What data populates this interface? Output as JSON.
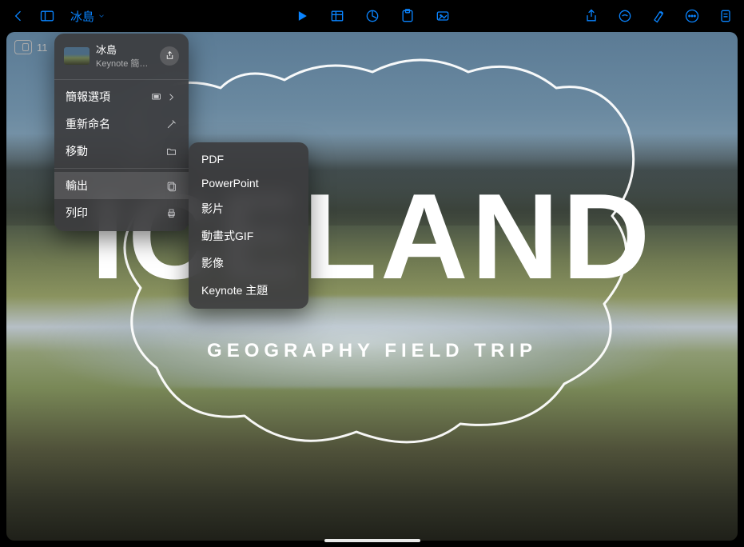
{
  "toolbar": {
    "doc_title": "冰島"
  },
  "slide_nav": {
    "count": "11"
  },
  "menu": {
    "header": {
      "title": "冰島",
      "subtitle": "Keynote 簡報⋯"
    },
    "items": {
      "options": "簡報選項",
      "rename": "重新命名",
      "move": "移動",
      "export": "輸出",
      "print": "列印"
    }
  },
  "submenu": {
    "pdf": "PDF",
    "powerpoint": "PowerPoint",
    "movie": "影片",
    "gif": "動畫式GIF",
    "images": "影像",
    "theme": "Keynote 主題"
  },
  "slide": {
    "title": "ICELAND",
    "subtitle": "GEOGRAPHY FIELD TRIP"
  }
}
